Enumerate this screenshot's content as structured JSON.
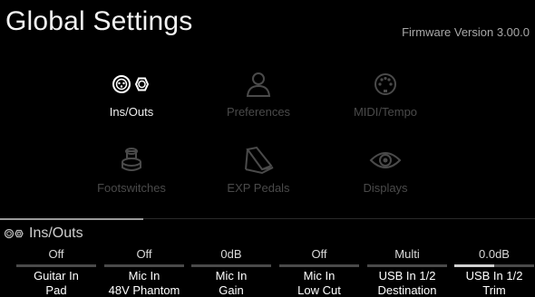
{
  "header": {
    "title": "Global Settings",
    "firmware": "Firmware Version 3.00.0"
  },
  "tiles": [
    {
      "label": "Ins/Outs",
      "icon": "inputs-outputs-icon",
      "active": true
    },
    {
      "label": "Preferences",
      "icon": "user-icon",
      "active": false
    },
    {
      "label": "MIDI/Tempo",
      "icon": "midi-port-icon",
      "active": false
    },
    {
      "label": "Footswitches",
      "icon": "footswitch-icon",
      "active": false
    },
    {
      "label": "EXP Pedals",
      "icon": "expression-pedal-icon",
      "active": false
    },
    {
      "label": "Displays",
      "icon": "eye-icon",
      "active": false
    }
  ],
  "section": {
    "title": "Ins/Outs",
    "icon": "inputs-outputs-icon"
  },
  "params": [
    {
      "value": "Off",
      "line1": "Guitar In",
      "line2": "Pad"
    },
    {
      "value": "Off",
      "line1": "Mic In",
      "line2": "48V Phantom"
    },
    {
      "value": "0dB",
      "line1": "Mic In",
      "line2": "Gain"
    },
    {
      "value": "Off",
      "line1": "Mic In",
      "line2": "Low Cut"
    },
    {
      "value": "Multi",
      "line1": "USB In 1/2",
      "line2": "Destination"
    },
    {
      "value": "0.0dB",
      "line1": "USB In 1/2",
      "line2": "Trim"
    }
  ],
  "colors": {
    "background": "#000000",
    "active_label": "#f0f0f0",
    "inactive": "#4a4a4a"
  }
}
